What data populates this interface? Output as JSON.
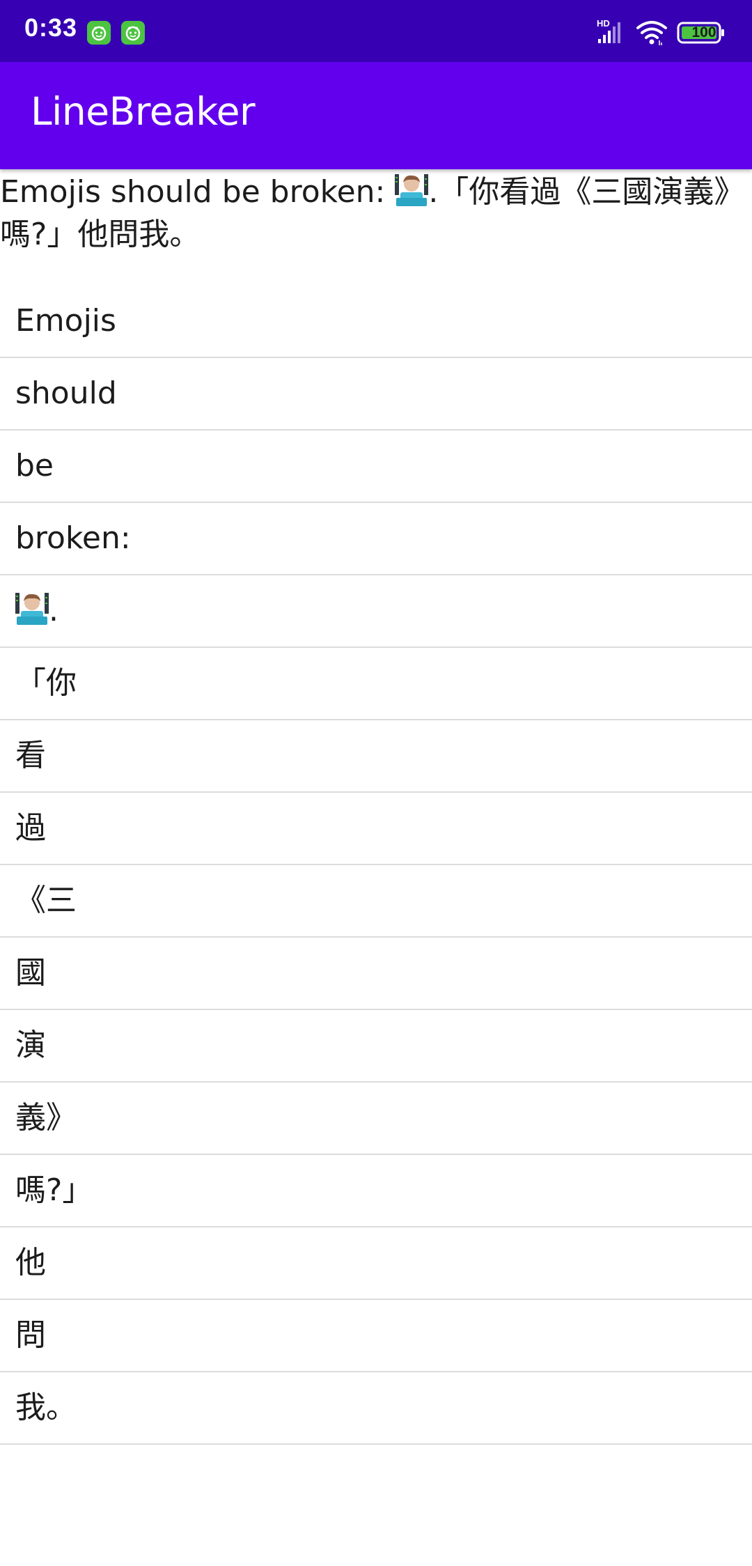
{
  "status_bar": {
    "time": "0:33",
    "network_label": "HD",
    "battery": "100",
    "notification_icons": [
      "app-notification-icon",
      "app-notification-icon"
    ]
  },
  "app_bar": {
    "title": "LineBreaker"
  },
  "sample": {
    "before_emoji": "Emojis should be broken: ",
    "emoji": "technologist-emoji",
    "after_emoji": ".「你看過《三國演義》嗎?」他問我。"
  },
  "tokens": [
    {
      "text": "Emojis"
    },
    {
      "text": "should"
    },
    {
      "text": "be"
    },
    {
      "text": "broken:"
    },
    {
      "text": ".",
      "emoji": "technologist-emoji"
    },
    {
      "text": "「你"
    },
    {
      "text": "看"
    },
    {
      "text": "過"
    },
    {
      "text": "《三"
    },
    {
      "text": "國"
    },
    {
      "text": "演"
    },
    {
      "text": "義》"
    },
    {
      "text": "嗎?」"
    },
    {
      "text": "他"
    },
    {
      "text": "問"
    },
    {
      "text": "我。"
    }
  ],
  "colors": {
    "status_bar": "#3700b3",
    "app_bar": "#6200ee",
    "divider": "#dcdcdc",
    "text": "#1c1c1c"
  }
}
